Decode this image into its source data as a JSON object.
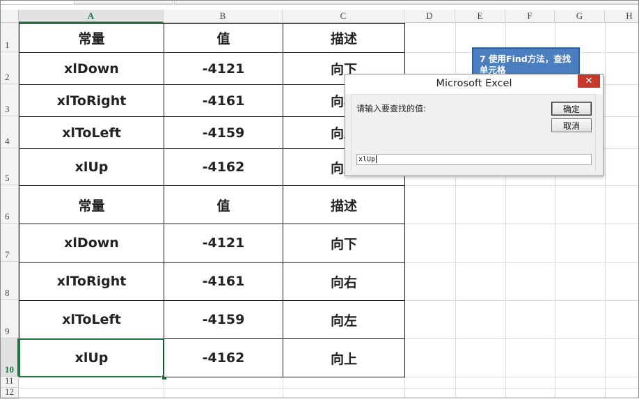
{
  "columns": [
    "A",
    "B",
    "C",
    "D",
    "E",
    "F",
    "G",
    "H"
  ],
  "rows": [
    "1",
    "2",
    "3",
    "4",
    "5",
    "6",
    "7",
    "8",
    "9",
    "10",
    "11",
    "12"
  ],
  "selected_cell": {
    "col": "A",
    "row": "10"
  },
  "table": [
    [
      "常量",
      "值",
      "描述"
    ],
    [
      "xlDown",
      "-4121",
      "向下"
    ],
    [
      "xlToRight",
      "-4161",
      "向右"
    ],
    [
      "xlToLeft",
      "-4159",
      "向左"
    ],
    [
      "xlUp",
      "-4162",
      "向上"
    ],
    [
      "常量",
      "值",
      "描述"
    ],
    [
      "xlDown",
      "-4121",
      "向下"
    ],
    [
      "xlToRight",
      "-4161",
      "向右"
    ],
    [
      "xlToLeft",
      "-4159",
      "向左"
    ],
    [
      "xlUp",
      "-4162",
      "向上"
    ]
  ],
  "callout": {
    "text": "7  使用Find方法，查找单元格"
  },
  "dialog": {
    "title": "Microsoft Excel",
    "close_glyph": "✕",
    "prompt": "请输入要查找的值:",
    "ok_label": "确定",
    "cancel_label": "取消",
    "input_value": "xlUp"
  },
  "colors": {
    "accent": "#217346",
    "callout": "#4a7ebf",
    "close": "#c7392b"
  }
}
